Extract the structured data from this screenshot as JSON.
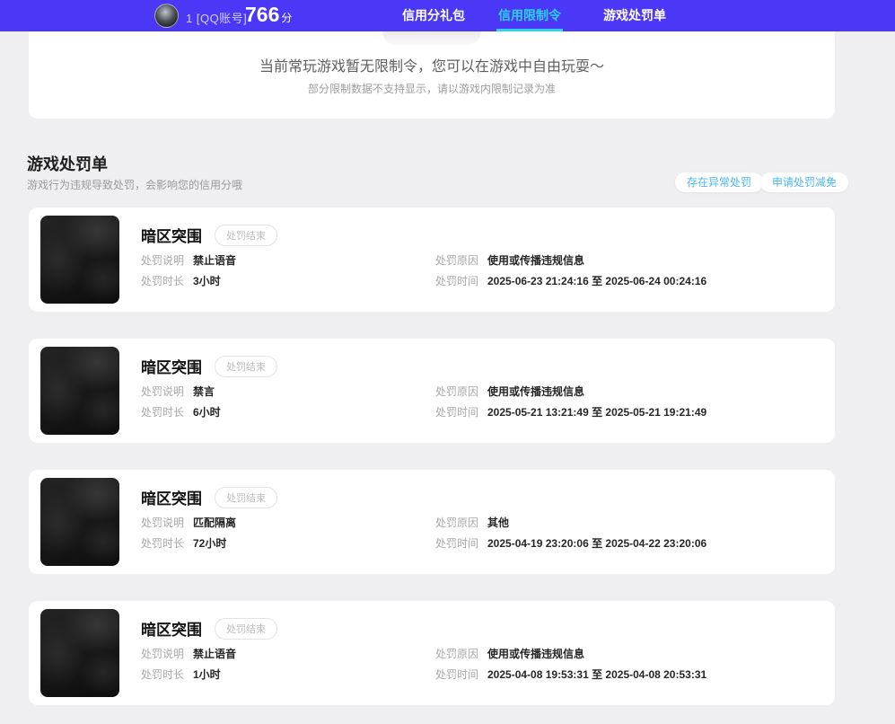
{
  "theme": {
    "header_bg": "#4b38f7",
    "active_tab_cyan": "#2ed1ee",
    "button_blue": "#4cb6f3",
    "page_bg": "#efeff1"
  },
  "header": {
    "account": "1 [QQ账号]",
    "score": "766",
    "score_unit": "分",
    "tabs": [
      {
        "label": "信用分礼包",
        "active": false
      },
      {
        "label": "信用限制令",
        "active": true
      },
      {
        "label": "游戏处罚单",
        "active": false
      }
    ]
  },
  "notice": {
    "main": "当前常玩游戏暂无限制令，您可以在游戏中自由玩耍～",
    "sub": "部分限制数据不支持显示，请以游戏内限制记录为准"
  },
  "section": {
    "title": "游戏处罚单",
    "subtitle": "游戏行为违规导致处罚，会影响您的信用分哦",
    "abnormal_button": "存在异常处罚",
    "relief_button": "申请处罚减免"
  },
  "labels": {
    "desc": "处罚说明",
    "duration": "处罚时长",
    "reason": "处罚原因",
    "time": "处罚时间"
  },
  "penalties": [
    {
      "game": "暗区突围",
      "status": "处罚结束",
      "desc": "禁止语音",
      "duration": "3小时",
      "reason": "使用或传播违规信息",
      "time": "2025-06-23 21:24:16 至 2025-06-24 00:24:16"
    },
    {
      "game": "暗区突围",
      "status": "处罚结束",
      "desc": "禁言",
      "duration": "6小时",
      "reason": "使用或传播违规信息",
      "time": "2025-05-21 13:21:49 至 2025-05-21 19:21:49"
    },
    {
      "game": "暗区突围",
      "status": "处罚结束",
      "desc": "匹配隔离",
      "duration": "72小时",
      "reason": "其他",
      "time": "2025-04-19 23:20:06 至 2025-04-22 23:20:06"
    },
    {
      "game": "暗区突围",
      "status": "处罚结束",
      "desc": "禁止语音",
      "duration": "1小时",
      "reason": "使用或传播违规信息",
      "time": "2025-04-08 19:53:31 至 2025-04-08 20:53:31"
    }
  ]
}
